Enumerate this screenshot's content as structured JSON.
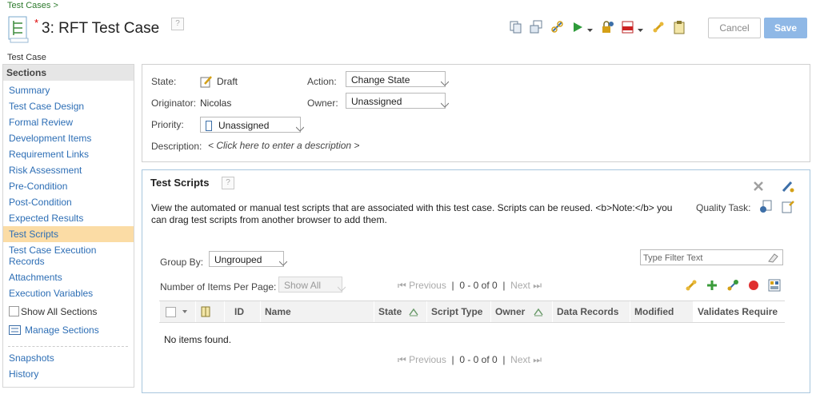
{
  "breadcrumb": "Test Cases >",
  "header": {
    "asterisk": "*",
    "title": "3: RFT Test Case",
    "help": "?",
    "cancel_label": "Cancel",
    "save_label": "Save"
  },
  "item_type": "Test Case",
  "sidebar": {
    "heading": "Sections",
    "items": [
      {
        "label": "Summary"
      },
      {
        "label": "Test Case Design"
      },
      {
        "label": "Formal Review"
      },
      {
        "label": "Development Items"
      },
      {
        "label": "Requirement Links"
      },
      {
        "label": "Risk Assessment"
      },
      {
        "label": "Pre-Condition"
      },
      {
        "label": "Post-Condition"
      },
      {
        "label": "Expected Results"
      },
      {
        "label": "Test Scripts"
      },
      {
        "label": "Test Case Execution Records"
      },
      {
        "label": "Attachments"
      },
      {
        "label": "Execution Variables"
      }
    ],
    "show_all_label": "Show All Sections",
    "manage_label": "Manage Sections",
    "snapshots_label": "Snapshots",
    "history_label": "History"
  },
  "overview": {
    "state_label": "State:",
    "state_value": "Draft",
    "action_label": "Action:",
    "action_value": "Change State",
    "originator_label": "Originator:",
    "originator_value": "Nicolas",
    "owner_label": "Owner:",
    "owner_value": "Unassigned",
    "priority_label": "Priority:",
    "priority_value": "Unassigned",
    "description_label": "Description:",
    "description_placeholder": "< Click here to enter a description >"
  },
  "scripts": {
    "title": "Test Scripts",
    "help": "?",
    "description": "View the automated or manual test scripts that are associated with this test case. Scripts can be reused. <b>Note:</b> you can drag test scripts from another browser to add them.",
    "quality_task_label": "Quality Task:",
    "group_by_label": "Group By:",
    "group_by_value": "Ungrouped",
    "filter_placeholder": "Type Filter Text",
    "items_per_page_label": "Number of Items Per Page:",
    "items_per_page_value": "Show All",
    "pager": {
      "previous": "Previous",
      "count": "0 - 0 of 0",
      "next": "Next",
      "sep": "|"
    },
    "columns": [
      "ID",
      "Name",
      "State",
      "Script Type",
      "Owner",
      "Data Records",
      "Modified",
      "Validates Require"
    ],
    "empty_message": "No items found."
  },
  "colors": {
    "link": "#2d6eb5",
    "selected": "#fbdca5",
    "save": "#8fb8e6",
    "panel_border": "#a8c6de"
  }
}
